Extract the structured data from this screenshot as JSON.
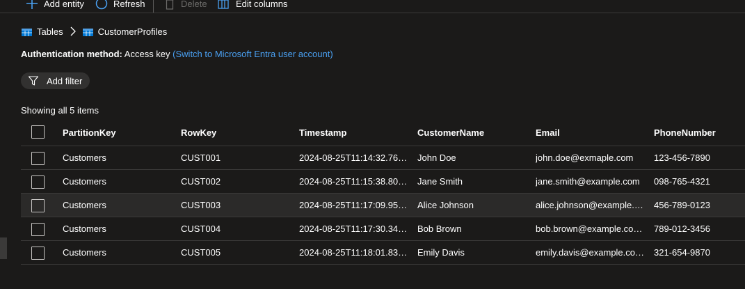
{
  "toolbar": {
    "add_entity": "Add entity",
    "refresh": "Refresh",
    "delete": "Delete",
    "edit_columns": "Edit columns"
  },
  "breadcrumb": {
    "root": "Tables",
    "current": "CustomerProfiles"
  },
  "auth": {
    "label": "Authentication method:",
    "value": "Access key",
    "link": "(Switch to Microsoft Entra user account)"
  },
  "filter": {
    "label": "Add filter"
  },
  "count_text": "Showing all 5 items",
  "columns": [
    "PartitionKey",
    "RowKey",
    "Timestamp",
    "CustomerName",
    "Email",
    "PhoneNumber"
  ],
  "rows": [
    {
      "partition": "Customers",
      "rowkey": "CUST001",
      "timestamp": "2024-08-25T11:14:32.76…",
      "name": "John Doe",
      "email": "john.doe@exmaple.com",
      "phone": "123-456-7890"
    },
    {
      "partition": "Customers",
      "rowkey": "CUST002",
      "timestamp": "2024-08-25T11:15:38.80…",
      "name": "Jane Smith",
      "email": "jane.smith@example.com",
      "phone": "098-765-4321"
    },
    {
      "partition": "Customers",
      "rowkey": "CUST003",
      "timestamp": "2024-08-25T11:17:09.95…",
      "name": "Alice Johnson",
      "email": "alice.johnson@example.…",
      "phone": "456-789-0123"
    },
    {
      "partition": "Customers",
      "rowkey": "CUST004",
      "timestamp": "2024-08-25T11:17:30.34…",
      "name": "Bob Brown",
      "email": "bob.brown@example.co…",
      "phone": "789-012-3456"
    },
    {
      "partition": "Customers",
      "rowkey": "CUST005",
      "timestamp": "2024-08-25T11:18:01.83…",
      "name": "Emily Davis",
      "email": "emily.davis@example.co…",
      "phone": "321-654-9870"
    }
  ],
  "colors": {
    "background": "#1b1a19",
    "link": "#4aa1f3",
    "accent": "#0078d4",
    "border": "#3b3a39"
  },
  "icons": {
    "add": "plus-icon",
    "refresh": "refresh-icon",
    "delete": "trash-icon",
    "edit_columns": "edit-columns-icon",
    "table": "table-icon",
    "filter": "funnel-icon"
  }
}
